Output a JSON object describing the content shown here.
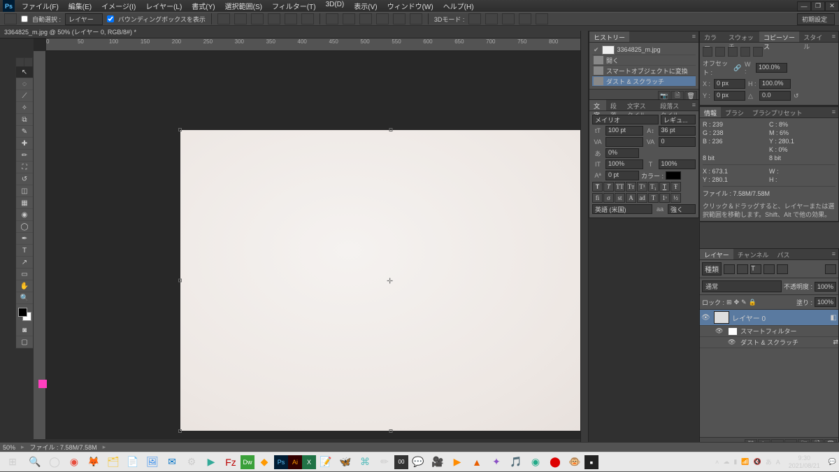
{
  "menu": {
    "file": "ファイル(F)",
    "edit": "編集(E)",
    "image": "イメージ(I)",
    "layer": "レイヤー(L)",
    "type": "書式(Y)",
    "select": "選択範囲(S)",
    "filter": "フィルター(T)",
    "threeD": "3D(D)",
    "view": "表示(V)",
    "window": "ウィンドウ(W)",
    "help": "ヘルプ(H)"
  },
  "options": {
    "auto_select": "自動選択 :",
    "auto_target": "レイヤー",
    "bounding": "バウンディングボックスを表示",
    "threeD_mode": "3Dモード :",
    "workspace": "初期設定"
  },
  "doc_tab": "3364825_m.jpg @ 50% (レイヤー 0, RGB/8#) *",
  "ruler_marks": [
    "0",
    "50",
    "100",
    "150",
    "200",
    "250",
    "300",
    "350",
    "400",
    "450",
    "500",
    "550",
    "600",
    "650",
    "700",
    "750",
    "800"
  ],
  "status": {
    "zoom": "50%",
    "filesize": "ファイル : 7.58M/7.58M"
  },
  "history": {
    "tab": "ヒストリー",
    "source": "3364825_m.jpg",
    "items": [
      {
        "label": "開く"
      },
      {
        "label": "スマートオブジェクトに変換"
      },
      {
        "label": "ダスト & スクラッチ"
      }
    ]
  },
  "character": {
    "tabs": {
      "char": "文字",
      "para": "段落",
      "char_style": "文字スタイル",
      "para_style": "段落スタイル"
    },
    "font": "メイリオ",
    "weight": "レギュ...",
    "size": "100 pt",
    "leading": "36 pt",
    "va": "VA",
    "va_val": "",
    "vert": "0",
    "scale": "0%",
    "hscale": "100%",
    "vscale": "100%",
    "baseline": "0 pt",
    "color_label": "カラー :",
    "lang": "英語 (米国)",
    "aa": "aa",
    "sharp": "強く"
  },
  "clonesrc": {
    "tabs": {
      "color": "カラー",
      "swatch": "スウォッチ",
      "copy": "コピーソース",
      "style": "スタイル"
    },
    "offset": "オフセット :",
    "w": "W :",
    "w_val": "100.0%",
    "h": "H :",
    "h_val": "100.0%",
    "x": "X :",
    "x_val": "0 px",
    "y": "Y :",
    "y_val": "0 px",
    "angle": "0.0"
  },
  "info": {
    "tabs": {
      "info": "情報",
      "brush": "ブラシ",
      "preset": "ブラシプリセット"
    },
    "r": "R :",
    "r_v": "239",
    "c": "C :",
    "c_v": "8%",
    "g": "G :",
    "g_v": "238",
    "m": "M :",
    "m_v": "6%",
    "b": "B :",
    "b_v": "236",
    "y": "Y :",
    "y_v": "280.1",
    "k": "K :",
    "k_v": "0%",
    "bit": "8 bit",
    "bit2": "8 bit",
    "x": "X :",
    "x_v": "673.1",
    "w": "W :",
    "y2": "Y :",
    "h2": "H :",
    "file": "ファイル : 7.58M/7.58M",
    "hint": "クリック＆ドラッグすると、レイヤーまたは選択範囲を移動します。Shift、Alt で他の効果。"
  },
  "layers": {
    "tabs": {
      "layers": "レイヤー",
      "channels": "チャンネル",
      "paths": "パス"
    },
    "kind": "種類",
    "mode": "通常",
    "opacity_label": "不透明度 :",
    "opacity": "100%",
    "lock": "ロック :",
    "fill_label": "塗り :",
    "fill": "100%",
    "layer0": "レイヤー 0",
    "smart_filter": "スマートフィルター",
    "dust": "ダスト & スクラッチ"
  },
  "taskbar": {
    "time": "9:30",
    "date": "2021/08/21"
  }
}
